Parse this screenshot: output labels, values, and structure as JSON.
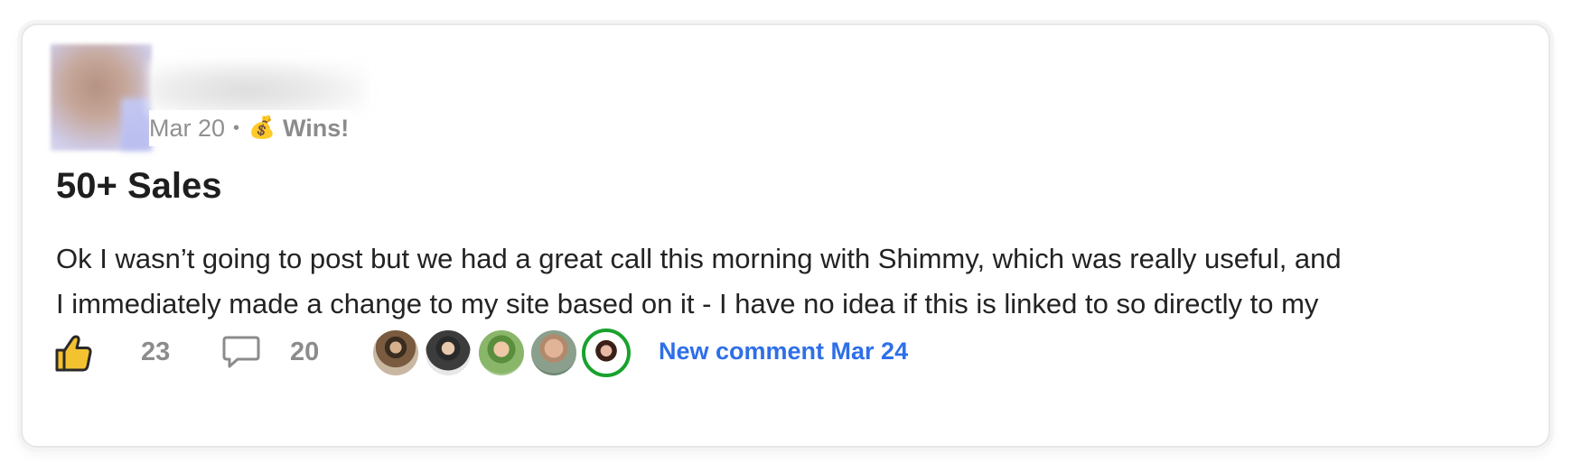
{
  "post": {
    "meta": {
      "date": "Mar 20",
      "separator": "•",
      "category_icon": "money-bag-icon",
      "category_label": "Wins!"
    },
    "title": "50+ Sales",
    "body_lines": [
      "Ok I wasn’t going to post but we had a great call this morning with Shimmy, which was really useful, and",
      "I immediately made a change to my site based on it - I have no idea if this is linked to so directly to my"
    ],
    "footer": {
      "like_icon": "thumbs-up-icon",
      "like_count": "23",
      "comment_icon": "comment-bubble-icon",
      "comment_count": "20",
      "commenter_avatars": 5,
      "new_comment_label": "New comment Mar 24"
    }
  },
  "colors": {
    "accent_link": "#2e6fe8",
    "muted_text": "#8c8c8c",
    "title_text": "#1e1e1e",
    "online_ring": "#18a22c",
    "like_icon_fill": "#f2c230"
  }
}
